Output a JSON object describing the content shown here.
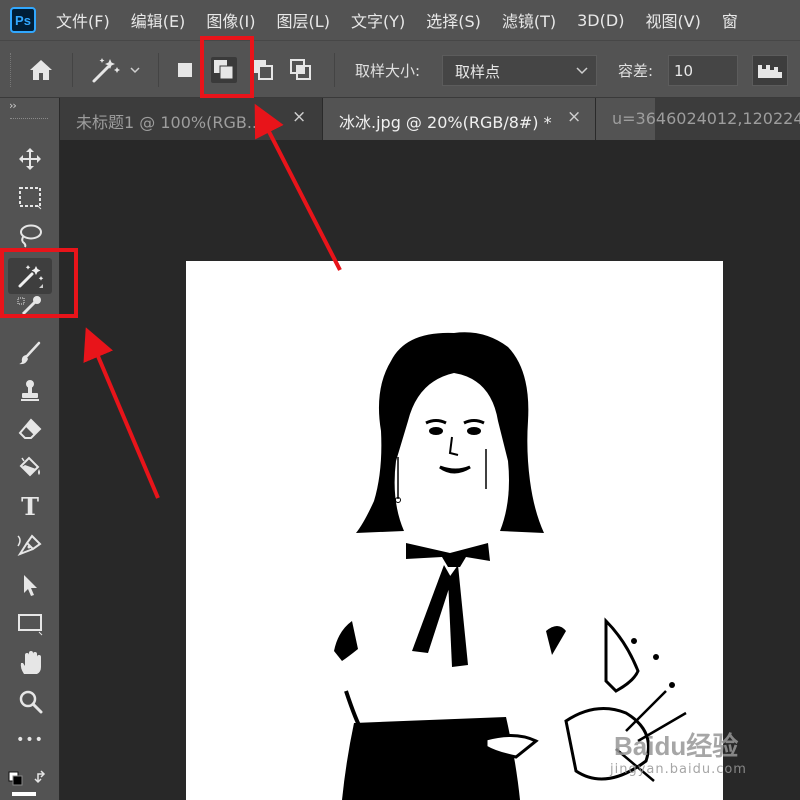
{
  "app": {
    "logo_text": "Ps"
  },
  "menu": [
    "文件(F)",
    "编辑(E)",
    "图像(I)",
    "图层(L)",
    "文字(Y)",
    "选择(S)",
    "滤镜(T)",
    "3D(D)",
    "视图(V)",
    "窗"
  ],
  "options_bar": {
    "sample_size_label": "取样大小:",
    "sample_size_value": "取样点",
    "tolerance_label": "容差:",
    "tolerance_value": "10",
    "selection_modes": [
      "new-selection",
      "add-to-selection",
      "subtract-from-selection",
      "intersect-with-selection"
    ],
    "active_mode": "add-to-selection"
  },
  "tool_panel": {
    "collapse_label": "››",
    "more_label": "•••",
    "tools": [
      "move",
      "rectangular-marquee",
      "lasso",
      "magic-wand",
      "eyedropper",
      "brush",
      "clone-stamp",
      "eraser",
      "paint-bucket",
      "type",
      "pen",
      "path-selection",
      "rectangle",
      "hand",
      "zoom"
    ],
    "active_tool": "magic-wand",
    "type_glyph": "T"
  },
  "tabs": [
    {
      "label": "未标题1 @ 100%(RGB...",
      "close": "×"
    },
    {
      "label": "冰冰.jpg @ 20%(RGB/8#) *",
      "close": "×"
    },
    {
      "label": "u=3646024012,120224"
    }
  ],
  "watermark": {
    "brand": "Baidu经验",
    "url": "jingyan.baidu.com"
  },
  "colors": {
    "annotation": "#e8141a",
    "panel": "#535353",
    "workspace": "#282828"
  }
}
